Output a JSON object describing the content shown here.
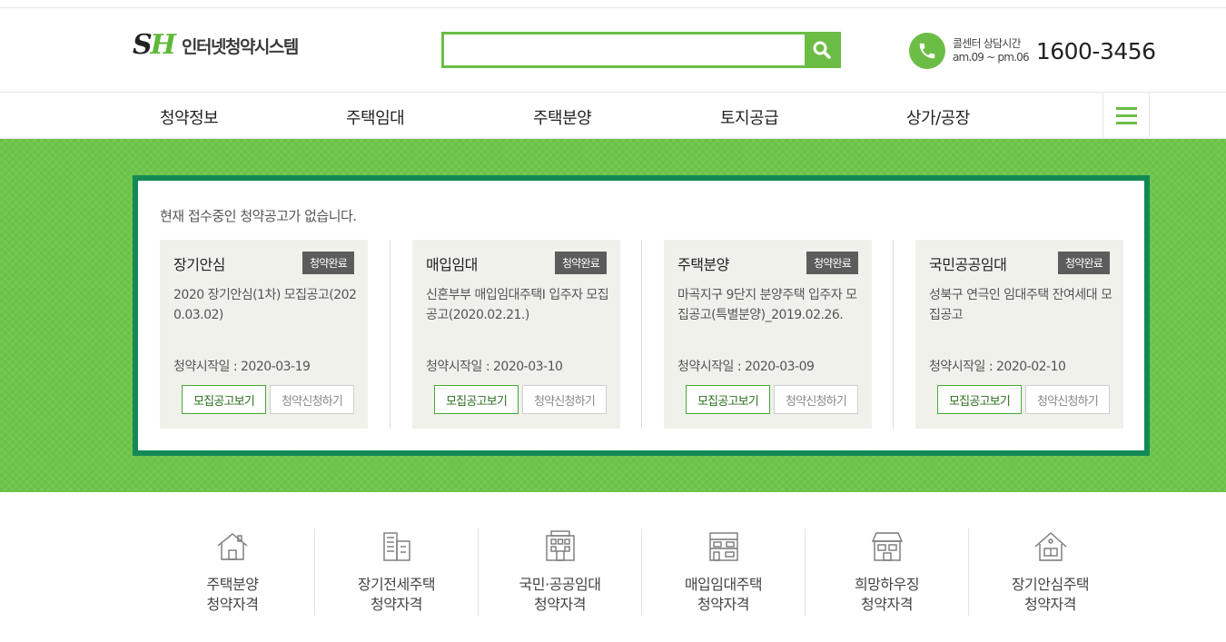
{
  "header": {
    "logo_mark_s": "S",
    "logo_mark_h": "H",
    "logo_text": "인터넷청약시스템",
    "search_value": "",
    "callcenter_label": "콜센터 상담시간",
    "callcenter_hours": "am.09 ~ pm.06",
    "callcenter_number": "1600-3456"
  },
  "nav": {
    "items": [
      {
        "label": "청약정보"
      },
      {
        "label": "주택임대"
      },
      {
        "label": "주택분양"
      },
      {
        "label": "토지공급"
      },
      {
        "label": "상가/공장"
      }
    ]
  },
  "notice": {
    "message": "현재 접수중인 청약공고가 없습니다.",
    "cards": [
      {
        "title": "장기안심",
        "badge": "청약완료",
        "desc": "2020 장기안심(1차) 모집공고(2020.03.02)",
        "date": "청약시작일 : 2020-03-19",
        "view_label": "모집공고보기",
        "apply_label": "청약신청하기"
      },
      {
        "title": "매입임대",
        "badge": "청약완료",
        "desc": "신혼부부 매입임대주택Ⅰ 입주자 모집공고(2020.02.21.)",
        "date": "청약시작일 : 2020-03-10",
        "view_label": "모집공고보기",
        "apply_label": "청약신청하기"
      },
      {
        "title": "주택분양",
        "badge": "청약완료",
        "desc": "마곡지구 9단지 분양주택 입주자 모집공고(특별분양)_2019.02.26.",
        "date": "청약시작일 : 2020-03-09",
        "view_label": "모집공고보기",
        "apply_label": "청약신청하기"
      },
      {
        "title": "국민공공임대",
        "badge": "청약완료",
        "desc": "성북구 연극인 임대주택 잔여세대 모집공고",
        "date": "청약시작일 : 2020-02-10",
        "view_label": "모집공고보기",
        "apply_label": "청약신청하기"
      }
    ]
  },
  "quick": {
    "items": [
      {
        "line1": "주택분양",
        "line2": "청약자격",
        "icon": "house-icon"
      },
      {
        "line1": "장기전세주택",
        "line2": "청약자격",
        "icon": "building-icon"
      },
      {
        "line1": "국민·공공임대",
        "line2": "청약자격",
        "icon": "apartment-icon"
      },
      {
        "line1": "매입임대주택",
        "line2": "청약자격",
        "icon": "townhouse-icon"
      },
      {
        "line1": "희망하우징",
        "line2": "청약자격",
        "icon": "store-house-icon"
      },
      {
        "line1": "장기안심주택",
        "line2": "청약자격",
        "icon": "home-icon"
      }
    ]
  },
  "colors": {
    "accent": "#6cbd45",
    "banner": "#6ac247",
    "box_border": "#138a56",
    "badge": "#5c5c5c"
  }
}
